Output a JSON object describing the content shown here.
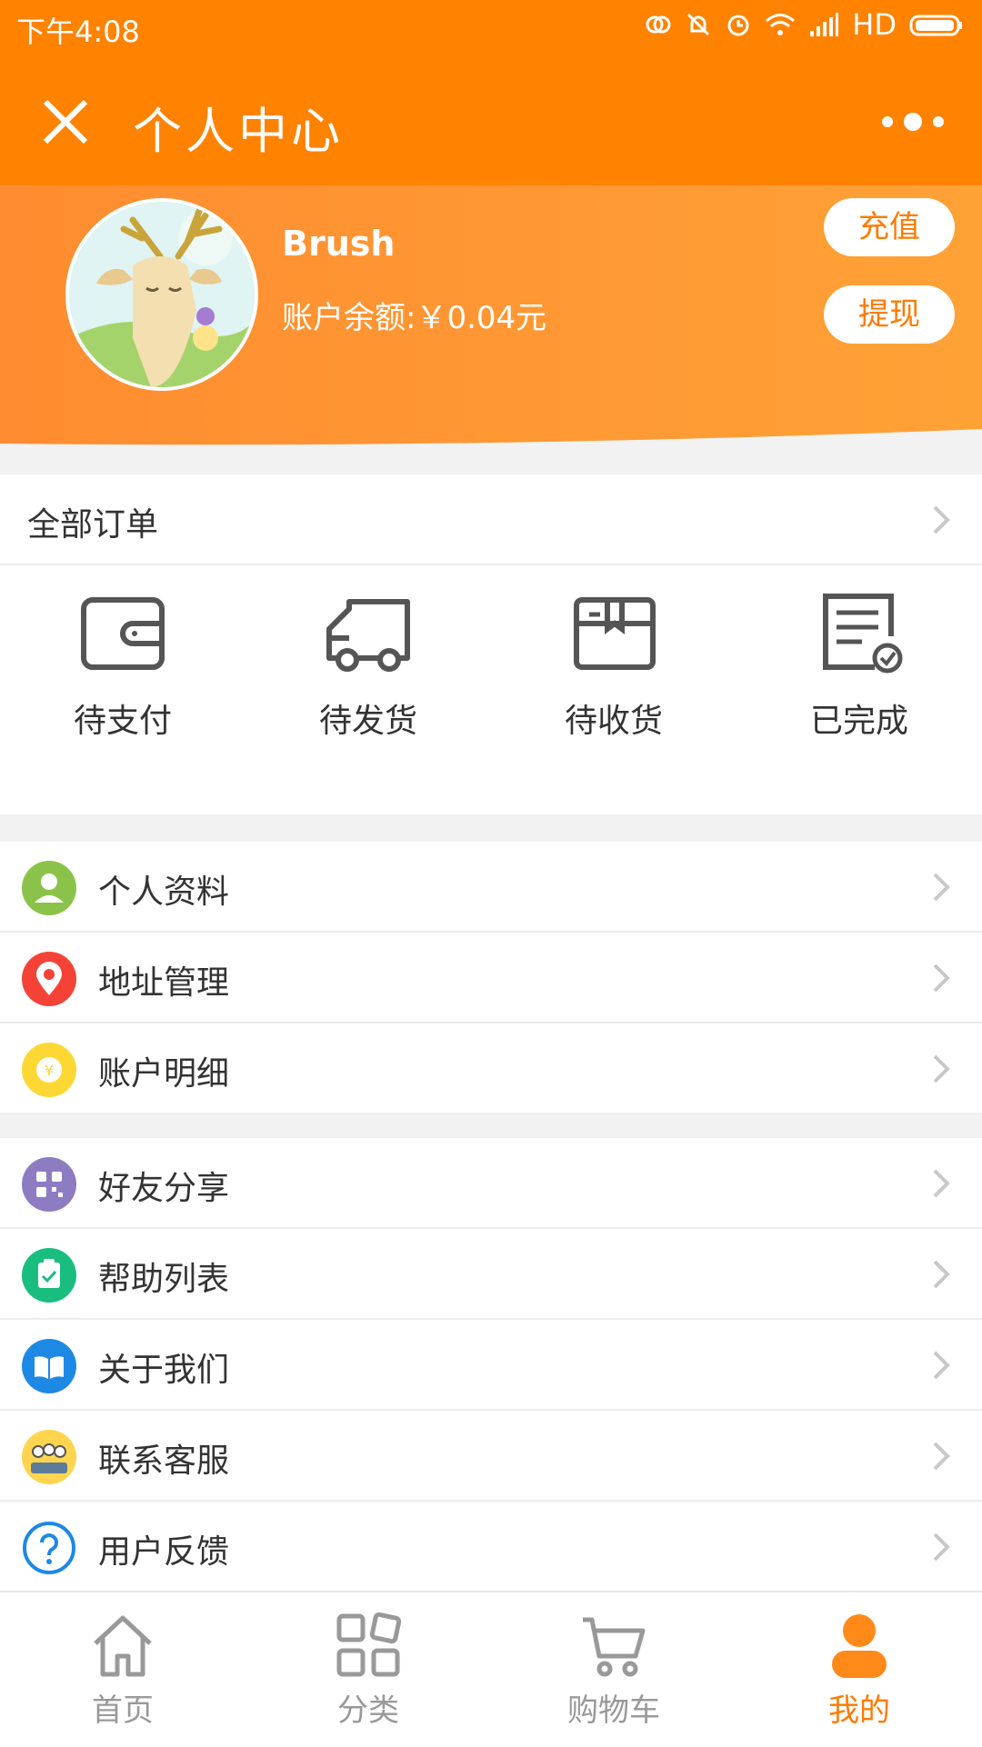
{
  "status": {
    "time": "下午4:08",
    "hd": "HD"
  },
  "titlebar": {
    "title": "个人中心"
  },
  "profile": {
    "username": "Brush",
    "balance": "账户余额:￥0.04元",
    "recharge": "充值",
    "withdraw": "提现"
  },
  "orders": {
    "all_label": "全部订单",
    "items": [
      {
        "label": "待支付",
        "icon": "wallet-icon"
      },
      {
        "label": "待发货",
        "icon": "truck-icon"
      },
      {
        "label": "待收货",
        "icon": "box-icon"
      },
      {
        "label": "已完成",
        "icon": "completed-doc-icon"
      }
    ]
  },
  "menu1": [
    {
      "label": "个人资料",
      "icon": "user-icon",
      "color": "#8bc34a"
    },
    {
      "label": "地址管理",
      "icon": "location-pin-icon",
      "color": "#f44336"
    },
    {
      "label": "账户明细",
      "icon": "yuan-coin-icon",
      "color": "#fdd835"
    }
  ],
  "menu2": [
    {
      "label": "好友分享",
      "icon": "qr-code-icon",
      "color": "#8e7cc3"
    },
    {
      "label": "帮助列表",
      "icon": "clipboard-check-icon",
      "color": "#19be7e"
    },
    {
      "label": "关于我们",
      "icon": "open-book-icon",
      "color": "#1e88e5"
    },
    {
      "label": "联系客服",
      "icon": "customer-service-icon",
      "color": "#ffd54f"
    },
    {
      "label": "用户反馈",
      "icon": "question-icon",
      "color": "#1e88e5"
    }
  ],
  "tabbar": [
    {
      "label": "首页",
      "icon": "home-icon"
    },
    {
      "label": "分类",
      "icon": "category-icon"
    },
    {
      "label": "购物车",
      "icon": "cart-icon"
    },
    {
      "label": "我的",
      "icon": "profile-icon",
      "active": true
    }
  ],
  "colors": {
    "accent": "#ff8201",
    "accent_light": "#ffa236",
    "inactive": "#999999"
  }
}
